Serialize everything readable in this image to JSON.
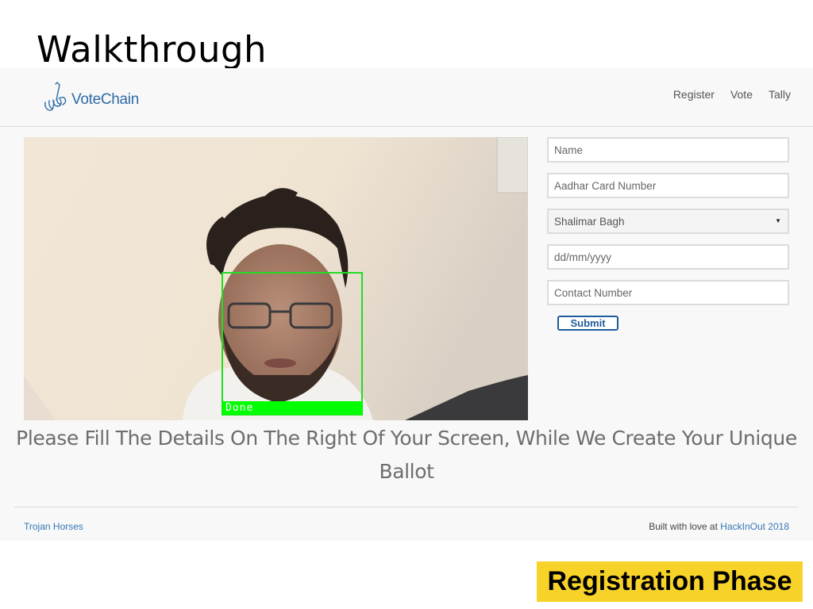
{
  "slide": {
    "title": "Walkthrough"
  },
  "brand": {
    "name": "VoteChain",
    "logo_icon": "voting-hands-logo-icon"
  },
  "nav": {
    "items": [
      {
        "label": "Register"
      },
      {
        "label": "Vote"
      },
      {
        "label": "Tally"
      }
    ]
  },
  "camera": {
    "status_label": "Done",
    "box_color": "#22dd22"
  },
  "form": {
    "name_placeholder": "Name",
    "aadhar_placeholder": "Aadhar Card Number",
    "constituency_value": "Shalimar Bagh",
    "dob_placeholder": "dd/mm/yyyy",
    "contact_placeholder": "Contact Number",
    "submit_label": "Submit"
  },
  "message": "Please Fill The Details On The Right Of Your Screen, While We Create Your Unique Ballot",
  "footer": {
    "left_link": "Trojan Horses",
    "right_text": "Built with love at",
    "right_link": "HackInOut 2018"
  },
  "badge": {
    "label": "Registration Phase",
    "color": "#f7d32a"
  },
  "colors": {
    "accent": "#2d6aa6",
    "link": "#3578b5",
    "submit": "#1f5c9c"
  }
}
